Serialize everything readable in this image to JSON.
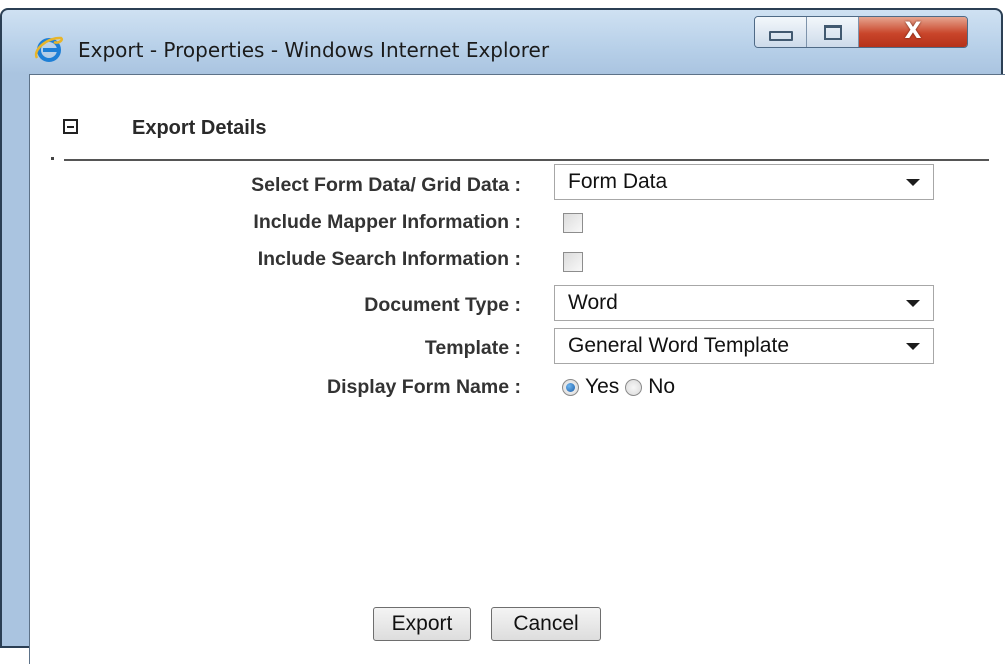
{
  "window": {
    "title": "Export - Properties - Windows Internet Explorer",
    "controls": {
      "close_glyph": "X"
    }
  },
  "section": {
    "title": "Export Details"
  },
  "form": {
    "select_data": {
      "label": "Select Form Data/ Grid Data :",
      "value": "Form Data"
    },
    "include_mapper": {
      "label": "Include Mapper Information :",
      "checked": false
    },
    "include_search": {
      "label": "Include Search Information :",
      "checked": false
    },
    "document_type": {
      "label": "Document Type :",
      "value": "Word"
    },
    "template": {
      "label": "Template :",
      "value": "General Word Template"
    },
    "display_form_name": {
      "label": "Display Form Name :",
      "options": [
        "Yes",
        "No"
      ],
      "selected": "Yes"
    }
  },
  "buttons": {
    "export": "Export",
    "cancel": "Cancel"
  },
  "colors": {
    "close_button": "#c9452a",
    "frame": "#aac4e0",
    "radio_selected": "#1b5da8"
  },
  "icons": [
    "internet-explorer-icon",
    "minimize-icon",
    "maximize-icon",
    "close-icon",
    "collapse-icon",
    "chevron-down-icon"
  ]
}
